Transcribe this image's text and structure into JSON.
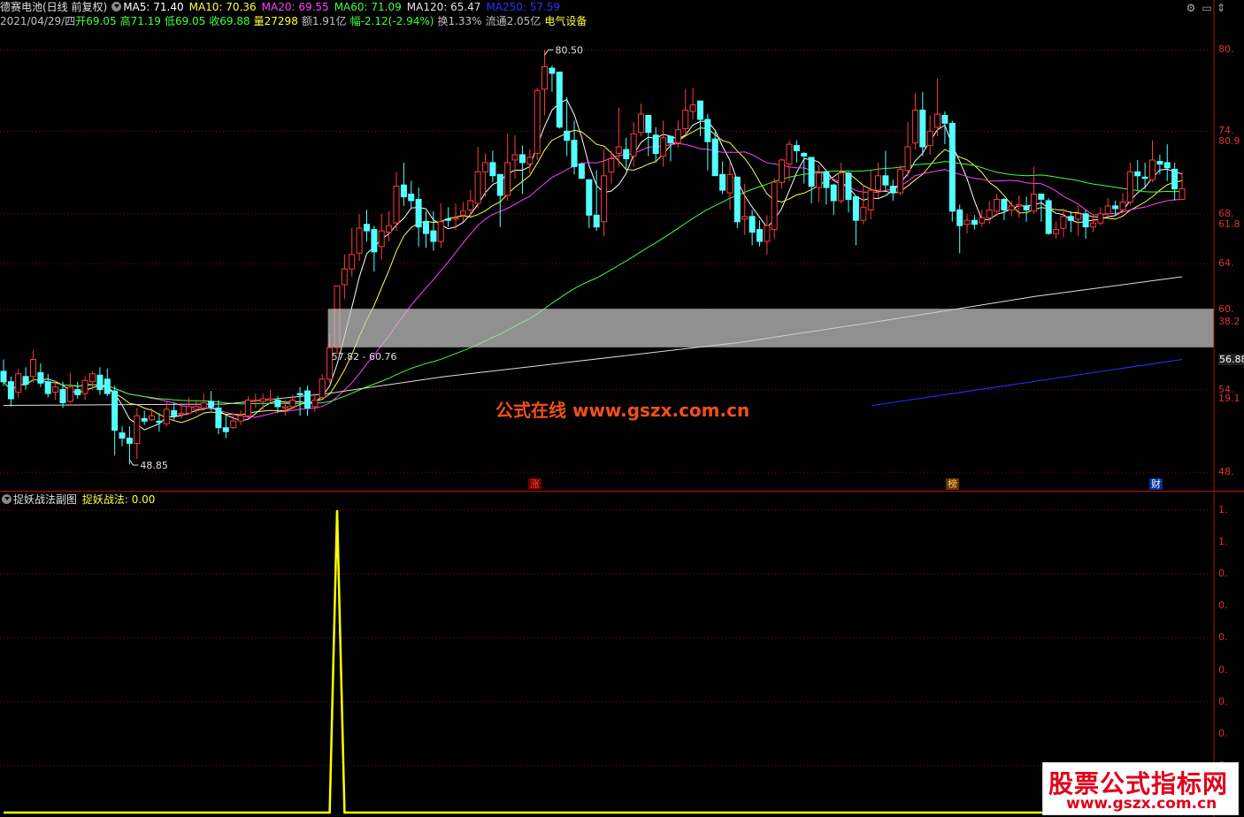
{
  "header": {
    "stock_name": "德赛电池(日线 前复权)",
    "ma_items": [
      {
        "label": "MA5: 71.40",
        "color": "#ffffff"
      },
      {
        "label": "MA10: 70.36",
        "color": "#ffff40"
      },
      {
        "label": "MA20: 69.55",
        "color": "#ff40ff"
      },
      {
        "label": "MA60: 71.09",
        "color": "#40ff40"
      },
      {
        "label": "MA120: 65.47",
        "color": "#e0e0e0"
      },
      {
        "label": "MA250: 57.59",
        "color": "#3030ff"
      }
    ],
    "info_items": [
      {
        "label": "2021/04/29/四",
        "color": "#c0c0c0"
      },
      {
        "label": "开69.05",
        "color": "#40ff40"
      },
      {
        "label": "高71.19",
        "color": "#40ff40"
      },
      {
        "label": "低69.05",
        "color": "#40ff40"
      },
      {
        "label": "收69.88",
        "color": "#40ff40"
      },
      {
        "label": "量27298",
        "color": "#ffff40"
      },
      {
        "label": "额1.91亿",
        "color": "#c0c0c0"
      },
      {
        "label": "幅-2.12(-2.94%)",
        "color": "#40ff40"
      },
      {
        "label": "换1.33%",
        "color": "#c0c0c0"
      },
      {
        "label": "流通2.05亿",
        "color": "#c0c0c0"
      },
      {
        "label": "电气设备",
        "color": "#ffff40"
      }
    ]
  },
  "subchart_header": {
    "name": "捉妖战法副图",
    "indicator": "捉妖战法: 0.00"
  },
  "price_axis_labels": [
    {
      "text": "80.",
      "value": 80.5,
      "color": "#e03030"
    },
    {
      "text": "74.",
      "value": 74.3,
      "color": "#e03030"
    },
    {
      "text": "80.9",
      "value": 73.5,
      "color": "#e03030"
    },
    {
      "text": "68.",
      "value": 68.0,
      "color": "#e03030"
    },
    {
      "text": "61.8",
      "value": 67.2,
      "color": "#e03030"
    },
    {
      "text": "64.",
      "value": 64.2,
      "color": "#e03030"
    },
    {
      "text": "60.",
      "value": 60.7,
      "color": "#e03030"
    },
    {
      "text": "38.2",
      "value": 59.8,
      "color": "#e03030"
    },
    {
      "text": "56.88",
      "value": 56.88,
      "color": "#ffffff"
    },
    {
      "text": "54.",
      "value": 54.6,
      "color": "#e03030"
    },
    {
      "text": "19.1",
      "value": 53.9,
      "color": "#e03030"
    },
    {
      "text": "48.",
      "value": 48.3,
      "color": "#e03030"
    }
  ],
  "sub_axis_labels": [
    "1.",
    "1.",
    "0.",
    "0.",
    "0.",
    "0.",
    "0.",
    "0.",
    "0.",
    "0."
  ],
  "annotations": {
    "high_label": "80.50",
    "low_label": "48.85",
    "zone_label": "57.82 - 60.76",
    "event_tags": [
      {
        "text": "涨",
        "color": "#ff4040",
        "bg": "#6a0000"
      },
      {
        "text": "榜",
        "color": "#ffd060",
        "bg": "#6a3000"
      },
      {
        "text": "财",
        "color": "#ffffff",
        "bg": "#0030a0"
      }
    ]
  },
  "watermarks": {
    "center": "公式在线  www.gszx.com.cn",
    "corner_title": "股票公式指标网",
    "corner_url": "www.gszx.com.cn"
  },
  "chart_data": [
    {
      "type": "candlestick",
      "title": "德赛电池(日线 前复权)",
      "y_range": [
        47.5,
        81.6
      ],
      "y_scale": "linear",
      "highlight_zone": [
        57.82,
        60.76
      ],
      "high": 80.5,
      "low": 48.85,
      "candles": [
        [
          56.0,
          55.2,
          56.9,
          54.9
        ],
        [
          55.2,
          53.9,
          55.6,
          53.3
        ],
        [
          54.4,
          55.8,
          56.2,
          54.0
        ],
        [
          55.6,
          55.0,
          56.3,
          54.6
        ],
        [
          55.6,
          56.9,
          57.6,
          55.1
        ],
        [
          55.9,
          55.1,
          56.6,
          54.8
        ],
        [
          55.2,
          54.3,
          55.8,
          54.0
        ],
        [
          54.4,
          54.8,
          55.3,
          53.8
        ],
        [
          54.6,
          53.6,
          55.2,
          53.2
        ],
        [
          53.7,
          54.8,
          55.9,
          53.6
        ],
        [
          54.6,
          54.2,
          55.2,
          53.9
        ],
        [
          54.3,
          55.3,
          55.6,
          53.8
        ],
        [
          55.2,
          55.8,
          56.0,
          54.6
        ],
        [
          55.7,
          54.6,
          56.3,
          54.2
        ],
        [
          55.4,
          54.3,
          56.2,
          54.1
        ],
        [
          54.5,
          51.5,
          54.9,
          49.6
        ],
        [
          51.3,
          50.9,
          51.8,
          50.3
        ],
        [
          50.9,
          50.5,
          51.8,
          48.9
        ],
        [
          50.5,
          52.6,
          53.2,
          49.3
        ],
        [
          52.4,
          52.2,
          53.0,
          51.9
        ],
        [
          52.3,
          52.6,
          53.2,
          52.2
        ],
        [
          52.2,
          52.1,
          52.8,
          51.4
        ],
        [
          52.0,
          53.1,
          53.7,
          51.8
        ],
        [
          53.0,
          52.6,
          53.6,
          52.3
        ],
        [
          52.7,
          52.8,
          53.6,
          52.4
        ],
        [
          52.8,
          53.3,
          54.0,
          52.7
        ],
        [
          53.1,
          53.3,
          53.7,
          52.8
        ],
        [
          53.2,
          53.6,
          54.3,
          53.0
        ],
        [
          53.7,
          53.3,
          54.5,
          53.0
        ],
        [
          53.2,
          51.7,
          53.8,
          51.2
        ],
        [
          51.7,
          51.4,
          52.6,
          50.9
        ],
        [
          51.7,
          52.2,
          52.8,
          51.6
        ],
        [
          52.2,
          52.6,
          53.0,
          51.9
        ],
        [
          52.6,
          53.8,
          54.1,
          52.4
        ],
        [
          53.8,
          53.8,
          54.3,
          53.2
        ],
        [
          53.7,
          53.9,
          54.3,
          53.1
        ],
        [
          53.8,
          53.9,
          54.6,
          53.6
        ],
        [
          53.8,
          53.3,
          54.1,
          52.8
        ],
        [
          53.2,
          53.3,
          53.8,
          52.6
        ],
        [
          53.3,
          53.8,
          54.2,
          53.1
        ],
        [
          54.3,
          54.2,
          54.8,
          52.6
        ],
        [
          54.5,
          53.2,
          54.9,
          52.6
        ],
        [
          53.3,
          53.8,
          54.3,
          52.9
        ],
        [
          54.0,
          55.4,
          55.8,
          53.9
        ],
        [
          55.4,
          57.8,
          58.8,
          55.1
        ],
        [
          57.8,
          62.5,
          62.5,
          57.3
        ],
        [
          62.6,
          63.8,
          64.9,
          61.5
        ],
        [
          63.8,
          64.9,
          66.9,
          63.2
        ],
        [
          65.0,
          66.9,
          68.0,
          64.4
        ],
        [
          67.2,
          66.7,
          68.3,
          65.9
        ],
        [
          66.8,
          65.1,
          67.1,
          63.6
        ],
        [
          65.5,
          66.7,
          68.0,
          64.5
        ],
        [
          66.6,
          67.1,
          68.2,
          65.9
        ],
        [
          67.3,
          70.1,
          71.2,
          66.7
        ],
        [
          70.2,
          69.3,
          71.9,
          68.6
        ],
        [
          69.5,
          69.0,
          70.5,
          68.4
        ],
        [
          69.1,
          67.0,
          70.0,
          65.5
        ],
        [
          67.4,
          66.5,
          68.2,
          65.4
        ],
        [
          66.7,
          65.9,
          68.2,
          65.2
        ],
        [
          65.9,
          67.4,
          68.8,
          65.4
        ],
        [
          67.6,
          67.5,
          68.5,
          67.0
        ],
        [
          67.6,
          67.7,
          68.8,
          66.8
        ],
        [
          67.9,
          68.2,
          68.9,
          67.4
        ],
        [
          68.3,
          69.0,
          69.8,
          67.8
        ],
        [
          68.8,
          71.2,
          73.1,
          68.4
        ],
        [
          71.2,
          71.9,
          72.6,
          69.3
        ],
        [
          71.9,
          70.9,
          72.8,
          70.4
        ],
        [
          71.0,
          69.4,
          70.9,
          67.0
        ],
        [
          69.4,
          71.9,
          74.1,
          69.0
        ],
        [
          72.1,
          72.5,
          74.0,
          70.7
        ],
        [
          72.5,
          71.9,
          73.2,
          69.5
        ],
        [
          71.8,
          72.3,
          72.9,
          71.1
        ],
        [
          72.6,
          77.4,
          77.6,
          72.1
        ],
        [
          77.5,
          79.2,
          80.5,
          75.5
        ],
        [
          79.1,
          78.7,
          79.3,
          77.3
        ],
        [
          78.8,
          74.6,
          78.4,
          74.5
        ],
        [
          74.3,
          73.6,
          76.9,
          72.4
        ],
        [
          73.6,
          71.6,
          75.1,
          71.0
        ],
        [
          71.8,
          70.7,
          71.8,
          70.7
        ],
        [
          70.6,
          67.9,
          70.6,
          66.9
        ],
        [
          67.9,
          67.0,
          71.3,
          66.7
        ],
        [
          67.4,
          70.9,
          72.9,
          66.3
        ],
        [
          71.2,
          72.2,
          72.8,
          70.3
        ],
        [
          72.6,
          73.1,
          76.1,
          71.6
        ],
        [
          72.9,
          72.2,
          73.8,
          71.3
        ],
        [
          72.4,
          74.1,
          75.0,
          71.6
        ],
        [
          74.2,
          75.6,
          76.4,
          73.9
        ],
        [
          75.5,
          74.2,
          74.9,
          72.4
        ],
        [
          74.0,
          72.6,
          74.6,
          71.9
        ],
        [
          72.4,
          73.8,
          75.1,
          71.6
        ],
        [
          73.9,
          73.4,
          73.9,
          72.0
        ],
        [
          73.4,
          74.4,
          75.1,
          73.0
        ],
        [
          74.5,
          75.9,
          77.5,
          74.0
        ],
        [
          75.8,
          76.3,
          77.6,
          75.2
        ],
        [
          76.6,
          75.2,
          76.0,
          73.9
        ],
        [
          75.2,
          73.5,
          75.6,
          71.3
        ],
        [
          73.7,
          70.9,
          74.4,
          70.9
        ],
        [
          71.0,
          69.8,
          72.0,
          69.5
        ],
        [
          69.6,
          71.0,
          71.9,
          68.3
        ],
        [
          70.8,
          67.4,
          70.5,
          66.9
        ],
        [
          67.6,
          67.8,
          70.3,
          66.4
        ],
        [
          67.8,
          66.6,
          68.3,
          65.6
        ],
        [
          66.8,
          65.9,
          67.5,
          65.5
        ],
        [
          65.9,
          67.1,
          67.9,
          64.9
        ],
        [
          66.8,
          70.4,
          70.7,
          66.1
        ],
        [
          70.4,
          72.1,
          72.2,
          69.9
        ],
        [
          71.8,
          73.3,
          73.6,
          70.5
        ],
        [
          73.2,
          72.8,
          73.6,
          71.9
        ],
        [
          72.6,
          72.4,
          72.7,
          70.3
        ],
        [
          72.3,
          70.1,
          72.3,
          68.8
        ],
        [
          70.0,
          71.1,
          71.7,
          68.9
        ],
        [
          71.2,
          70.0,
          71.2,
          68.7
        ],
        [
          70.2,
          69.0,
          70.3,
          67.9
        ],
        [
          69.0,
          71.1,
          71.9,
          68.8
        ],
        [
          71.1,
          69.1,
          71.2,
          68.1
        ],
        [
          69.3,
          67.5,
          69.4,
          65.6
        ],
        [
          67.5,
          68.5,
          70.2,
          67.2
        ],
        [
          68.3,
          69.8,
          71.3,
          67.6
        ],
        [
          69.8,
          70.9,
          71.9,
          69.2
        ],
        [
          70.9,
          70.2,
          72.8,
          69.8
        ],
        [
          70.1,
          69.6,
          70.6,
          69.0
        ],
        [
          69.6,
          71.4,
          71.7,
          69.4
        ],
        [
          71.3,
          73.1,
          75.0,
          70.8
        ],
        [
          73.4,
          75.9,
          77.2,
          72.9
        ],
        [
          75.9,
          73.1,
          77.3,
          72.4
        ],
        [
          73.2,
          74.3,
          75.5,
          72.5
        ],
        [
          74.6,
          75.6,
          78.3,
          73.9
        ],
        [
          75.5,
          74.9,
          75.8,
          73.3
        ],
        [
          74.9,
          68.2,
          75.1,
          67.4
        ],
        [
          68.3,
          67.1,
          68.7,
          65.0
        ],
        [
          67.2,
          67.5,
          68.0,
          66.5
        ],
        [
          67.5,
          67.2,
          67.9,
          66.8
        ],
        [
          67.3,
          67.7,
          68.3,
          67.0
        ],
        [
          67.7,
          68.3,
          69.0,
          67.2
        ],
        [
          68.2,
          69.1,
          69.5,
          67.8
        ],
        [
          69.1,
          68.3,
          69.2,
          67.5
        ],
        [
          68.3,
          68.6,
          69.0,
          67.8
        ],
        [
          68.6,
          68.7,
          69.4,
          67.7
        ],
        [
          68.6,
          68.3,
          69.3,
          67.4
        ],
        [
          68.2,
          69.5,
          71.6,
          68.0
        ],
        [
          69.5,
          69.1,
          69.3,
          67.4
        ],
        [
          69.0,
          66.5,
          69.2,
          66.4
        ],
        [
          66.5,
          66.8,
          67.4,
          66.1
        ],
        [
          66.9,
          67.8,
          68.4,
          66.2
        ],
        [
          67.8,
          67.5,
          68.2,
          66.6
        ],
        [
          67.6,
          68.0,
          68.6,
          66.3
        ],
        [
          68.0,
          67.0,
          68.3,
          66.1
        ],
        [
          67.0,
          67.3,
          67.9,
          66.6
        ],
        [
          67.3,
          68.0,
          68.5,
          67.1
        ],
        [
          68.0,
          68.6,
          69.2,
          67.7
        ],
        [
          68.6,
          68.4,
          69.0,
          67.9
        ],
        [
          68.3,
          68.9,
          69.6,
          68.1
        ],
        [
          68.9,
          71.2,
          71.9,
          68.7
        ],
        [
          71.2,
          70.9,
          72.1,
          69.8
        ],
        [
          70.8,
          70.7,
          71.9,
          69.9
        ],
        [
          70.6,
          72.1,
          73.6,
          70.4
        ],
        [
          72.0,
          71.8,
          72.5,
          71.0
        ],
        [
          71.9,
          71.5,
          73.3,
          70.5
        ],
        [
          71.4,
          69.9,
          71.9,
          69.0
        ],
        [
          69.1,
          69.9,
          71.2,
          69.1
        ]
      ]
    },
    {
      "type": "line",
      "title": "捉妖战法副图",
      "series": [
        {
          "name": "捉妖战法",
          "color": "#ffff00"
        }
      ],
      "y_range": [
        0,
        1
      ],
      "baseline": 0,
      "pulse": {
        "start_index": 44,
        "peak_index": 45,
        "end_index": 46,
        "value": 1.0
      },
      "bars": 160
    }
  ]
}
